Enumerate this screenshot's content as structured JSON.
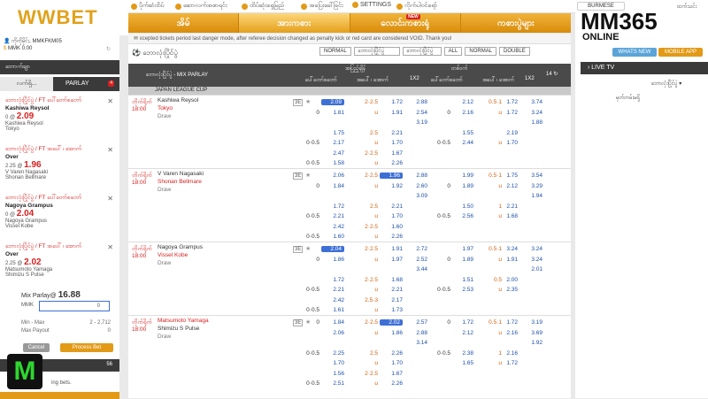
{
  "brand": {
    "logo": "WWBET",
    "logo2": "MM365",
    "logo2_sub": "ONLINE"
  },
  "toplinks": [
    "ပိုက်ဆံထိပ်",
    "ဆောလက်အစာရင်း",
    "ထိပ်ဆုံးရှေမြည်",
    "အပြေးခေါ်ခြင်း",
    "SETTINGS",
    "လိုက်ပါဝင်ရော်"
  ],
  "nav": {
    "tabs": [
      "အိမ်",
      "အားကစား",
      "လောင်းကစားရုံ",
      "ကစားပွဲများ"
    ],
    "new": "NEW"
  },
  "ticker": "xcepted tickets period last danger mode, after referee decision changed as penalty kick or red card are considered VOID. Thank you!",
  "account": {
    "user": "ကိုကိုမိုင်း, MMKFKM05",
    "balance": "MMK 0.00"
  },
  "left": {
    "hdr": "ဘောက်ချာ",
    "tab1": "လက်ရှိ...",
    "tab2": "PARLAY",
    "badge": "4",
    "bets": [
      {
        "title": "ဘောလုံးပြိုင်ပွဲ / FT ပေါ်တော်စတော်",
        "team": "Kashiwa Reysol",
        "line": "0 @",
        "odd": "2.09",
        "m1": "Kashiwa Reysol",
        "m2": "Tokyo"
      },
      {
        "title": "ဘောလုံးပြိုင်ပွဲ / FT အပေါ် ၊ အောက်",
        "team": "Over",
        "line": "2.25 @",
        "odd": "1.96",
        "m1": "V Varen Nagasaki",
        "m2": "Shonan Bellmare"
      },
      {
        "title": "ဘောလုံးပြိုင်ပွဲ / FT ပေါ်တော်စတော်",
        "team": "Nagoya Grampus",
        "line": "0 @",
        "odd": "2.04",
        "m1": "Nagoya Grampus",
        "m2": "Vissel Kobe"
      },
      {
        "title": "ဘောလုံးပြိုင်ပွဲ / FT အပေါ် ၊ အောက်",
        "team": "Over",
        "line": "2.25 @",
        "odd": "2.02",
        "m1": "Matsumoto Yamaga",
        "m2": "Shimizu S Pulse"
      }
    ],
    "mix_label": "Mix Parlay@",
    "mix_odd": "16.88",
    "cur": "MMK",
    "stake": "0",
    "minmax_label": "Min - Max",
    "minmax": "2 - 2,712",
    "payout_label": "Max Payout",
    "payout": "0",
    "cancel": "Cancel",
    "process": "Process Bet",
    "count_hdr": "56",
    "bets_text": "ing bets."
  },
  "center": {
    "title": "ဘောလုံးပြိုင်ပွဲ",
    "filters": [
      "NORMAL",
      "ဘောလုံးပြိုင်ပွဲ",
      "ALL",
      "NORMAL",
      "DOUBLE"
    ],
    "hdr_left": "ဘောလုံးပြိုင်ပွဲ - MIX PARLAY",
    "hdr_ft": "အပြည့်ချိန်",
    "hdr_ht": "တစ်ဝက်",
    "col_hdp": "ပေါ်တော်စတော်",
    "col_ou": "အပေါ် ၊ အောက်",
    "col_1x2": "1X2",
    "count": "14",
    "league": "JAPAN LEAGUE CUP",
    "matches": [
      {
        "time": "တိုက်ရိုက်\n18:00",
        "home": "Kashiwa Reysol",
        "away": "Tokyo",
        "draw": "Draw",
        "homeRed": false,
        "awayRed": true,
        "rows": [
          [
            "",
            "2.09",
            "2·2.5",
            "1.72",
            "2.88",
            "",
            "2.12",
            "0.5·1",
            "1.72",
            "3.74"
          ],
          [
            "0",
            "1.81",
            "u",
            "1.91",
            "2.54",
            "0",
            "2.16",
            "u",
            "1.72",
            "3.24"
          ],
          [
            "",
            "",
            "",
            "",
            "3.19",
            "",
            "",
            "",
            "",
            "1.88"
          ],
          [
            "",
            "1.75",
            "2.5",
            "2.21",
            "",
            "",
            "1.55",
            "",
            "2.19",
            ""
          ],
          [
            "0·0.5",
            "2.17",
            "u",
            "1.70",
            "",
            "0·0.5",
            "2.44",
            "u",
            "1.70",
            ""
          ],
          [
            "",
            "2.47",
            "2·2.5",
            "1.67",
            "",
            "",
            "",
            "",
            "",
            ""
          ],
          [
            "0·0.5",
            "1.58",
            "u",
            "2.26",
            "",
            "",
            "",
            "",
            "",
            ""
          ]
        ],
        "hl": [
          0,
          1
        ]
      },
      {
        "time": "တိုက်ရိုက်\n18:00",
        "home": "V Varen Nagasaki",
        "away": "Shonan Bellmare",
        "draw": "Draw",
        "homeRed": false,
        "awayRed": true,
        "rows": [
          [
            "",
            "2.06",
            "2·2.5",
            "1.96",
            "2.88",
            "",
            "1.99",
            "0.5·1",
            "1.75",
            "3.54"
          ],
          [
            "0",
            "1.84",
            "u",
            "1.92",
            "2.60",
            "0",
            "1.89",
            "u",
            "2.12",
            "3.29"
          ],
          [
            "",
            "",
            "",
            "",
            "3.09",
            "",
            "",
            "",
            "",
            "1.94"
          ],
          [
            "",
            "1.72",
            "2.5",
            "2.21",
            "",
            "",
            "1.50",
            "1",
            "2.21",
            ""
          ],
          [
            "0·0.5",
            "2.21",
            "u",
            "1.70",
            "",
            "0·0.5",
            "2.56",
            "u",
            "1.68",
            ""
          ],
          [
            "",
            "2.42",
            "2·2.5",
            "1.60",
            "",
            "",
            "",
            "",
            "",
            ""
          ],
          [
            "0·0.5",
            "1.60",
            "u",
            "2.26",
            "",
            "",
            "",
            "",
            "",
            ""
          ]
        ],
        "hl": [
          0,
          3
        ]
      },
      {
        "time": "တိုက်ရိုက်\n18:00",
        "home": "Nagoya Grampus",
        "away": "Vissel Kobe",
        "draw": "Draw",
        "homeRed": false,
        "awayRed": true,
        "rows": [
          [
            "",
            "2.04",
            "2·2.5",
            "1.91",
            "2.72",
            "",
            "1.97",
            "0.5·1",
            "3.24",
            "3.24"
          ],
          [
            "0",
            "1.86",
            "u",
            "1.97",
            "2.52",
            "0",
            "1.89",
            "u",
            "1.91",
            "3.24"
          ],
          [
            "",
            "",
            "",
            "",
            "3.44",
            "",
            "",
            "",
            "",
            "2.01"
          ],
          [
            "",
            "1.72",
            "2·2.5",
            "1.68",
            "",
            "",
            "1.51",
            "0.5",
            "2.00",
            ""
          ],
          [
            "0·0.5",
            "2.21",
            "u",
            "2.21",
            "",
            "0·0.5",
            "2.53",
            "u",
            "2.35",
            ""
          ],
          [
            "",
            "2.42",
            "2.5·3",
            "2.17",
            "",
            "",
            "",
            "",
            "",
            ""
          ],
          [
            "0·0.5",
            "1.61",
            "u",
            "1.73",
            "",
            "",
            "",
            "",
            "",
            ""
          ]
        ],
        "hl": [
          0,
          1
        ]
      },
      {
        "time": "တိုက်ရိုက်\n18:00",
        "home": "Matsumoto Yamaga",
        "away": "Shimizu S Pulse",
        "draw": "Draw",
        "homeRed": true,
        "awayRed": false,
        "rows": [
          [
            "0",
            "1.84",
            "2·2.5",
            "2.02",
            "2.57",
            "0",
            "1.72",
            "0.5·1",
            "1.72",
            "3.19"
          ],
          [
            "",
            "2.06",
            "u",
            "1.86",
            "2.88",
            "",
            "2.12",
            "u",
            "2.16",
            "3.69"
          ],
          [
            "",
            "",
            "",
            "",
            "3.14",
            "",
            "",
            "",
            "",
            "1.92"
          ],
          [
            "0·0.5",
            "2.25",
            "2.5",
            "2.26",
            "",
            "0·0.5",
            "2.38",
            "1",
            "2.16",
            ""
          ],
          [
            "",
            "1.70",
            "u",
            "1.70",
            "",
            "",
            "1.65",
            "u",
            "1.72",
            ""
          ],
          [
            "",
            "1.56",
            "2·2.5",
            "1.67",
            "",
            "",
            "",
            "",
            "",
            ""
          ],
          [
            "0·0.5",
            "2.51",
            "u",
            "2.26",
            "",
            "",
            "",
            "",
            "",
            ""
          ]
        ],
        "hl": [
          0,
          3
        ]
      }
    ]
  },
  "right": {
    "lang": "BURMESE",
    "chat": "ထက်သင်း",
    "whats": "WHATS NEW",
    "mobile": "MOBILE APP",
    "live": "LIVE TV",
    "sport": "ဘောလုံးပြိုင်ပွဲ",
    "nolive": "မှတ်တမ်းမရှိ"
  },
  "colors": {
    "accent": "#e8a21f",
    "red": "#d72020",
    "blue": "#1d4fa8"
  }
}
